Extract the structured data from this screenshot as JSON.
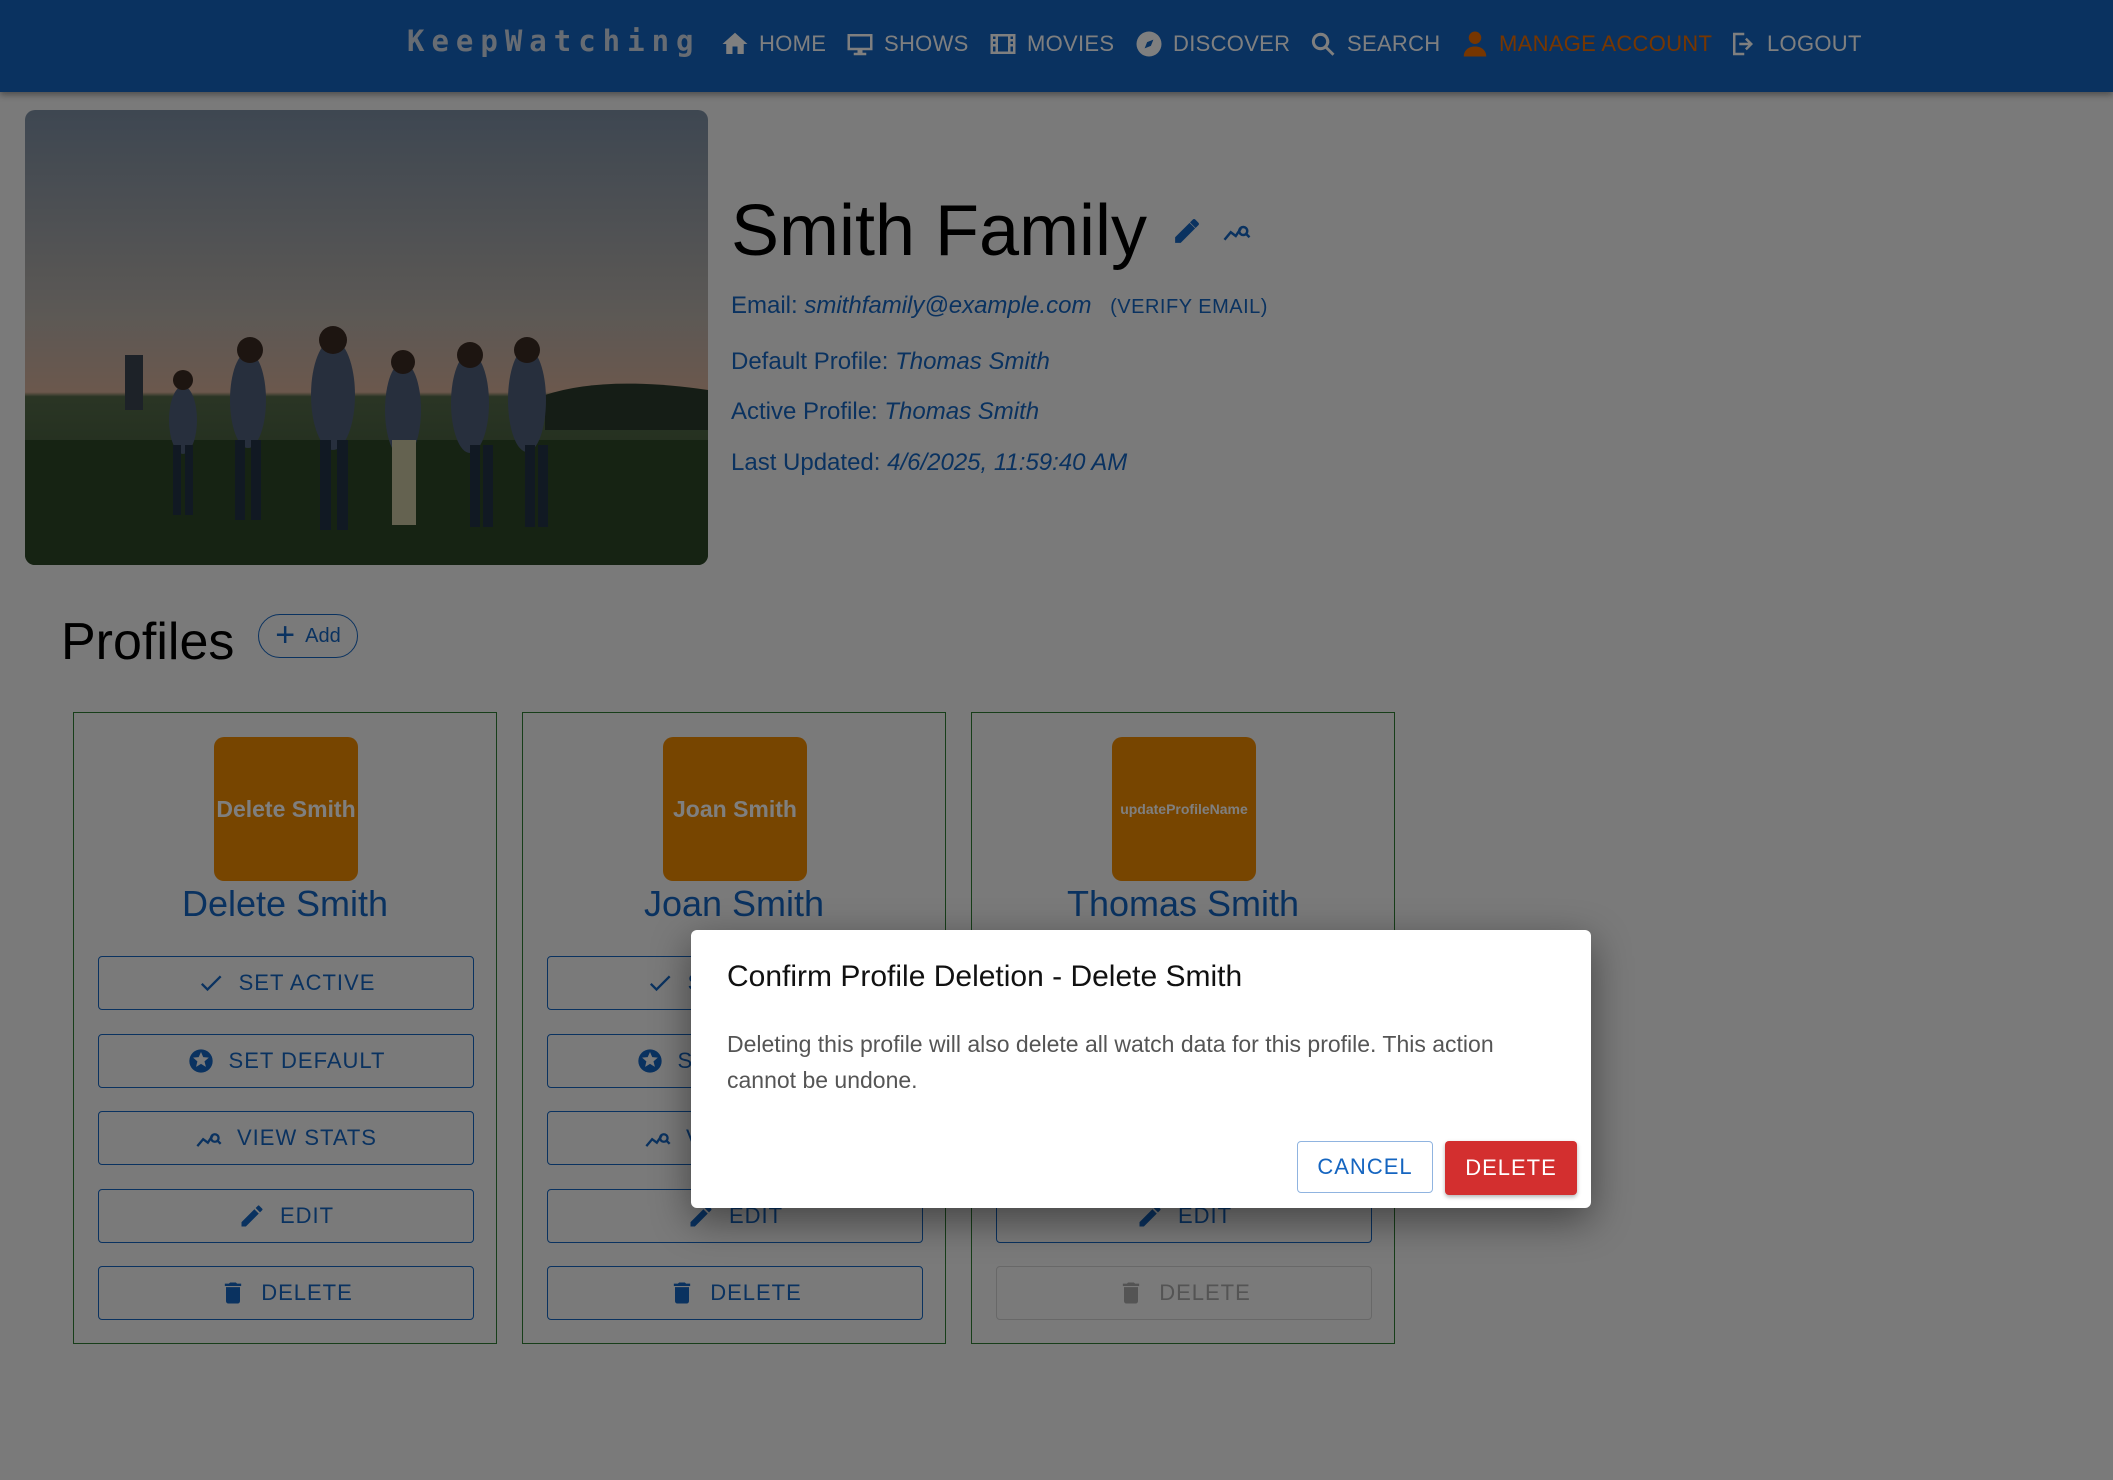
{
  "nav": {
    "brand": "KeepWatching",
    "items": [
      {
        "label": "HOME",
        "icon": "home-icon"
      },
      {
        "label": "SHOWS",
        "icon": "monitor-icon"
      },
      {
        "label": "MOVIES",
        "icon": "film-icon"
      },
      {
        "label": "DISCOVER",
        "icon": "compass-icon"
      },
      {
        "label": "SEARCH",
        "icon": "search-icon"
      },
      {
        "label": "MANAGE ACCOUNT",
        "icon": "person-icon",
        "active": true
      },
      {
        "label": "LOGOUT",
        "icon": "logout-icon"
      }
    ],
    "active_color": "#ef6c00",
    "bar_color": "#1565c0"
  },
  "account": {
    "name": "Smith Family",
    "email_label": "Email:",
    "email": "smithfamily@example.com",
    "verify_label": "(VERIFY EMAIL)",
    "default_label": "Default Profile:",
    "default_profile": "Thomas Smith",
    "active_label": "Active Profile:",
    "active_profile": "Thomas Smith",
    "updated_label": "Last Updated:",
    "last_updated": "4/6/2025, 11:59:40 AM"
  },
  "profiles": {
    "title": "Profiles",
    "add_label": "Add",
    "cards": [
      {
        "avatar_text": "Delete Smith",
        "name": "Delete Smith"
      },
      {
        "avatar_text": "Joan Smith",
        "name": "Joan Smith"
      },
      {
        "avatar_text": "updateProfileName",
        "name": "Thomas Smith"
      }
    ],
    "buttons": {
      "set_active": "SET ACTIVE",
      "set_default": "SET DEFAULT",
      "view_stats": "VIEW STATS",
      "edit": "EDIT",
      "delete": "DELETE"
    }
  },
  "dialog": {
    "title": "Confirm Profile Deletion - Delete Smith",
    "body": "Deleting this profile will also delete all watch data for this profile. This action cannot be undone.",
    "cancel": "CANCEL",
    "delete": "DELETE",
    "delete_color": "#d32f2f"
  }
}
